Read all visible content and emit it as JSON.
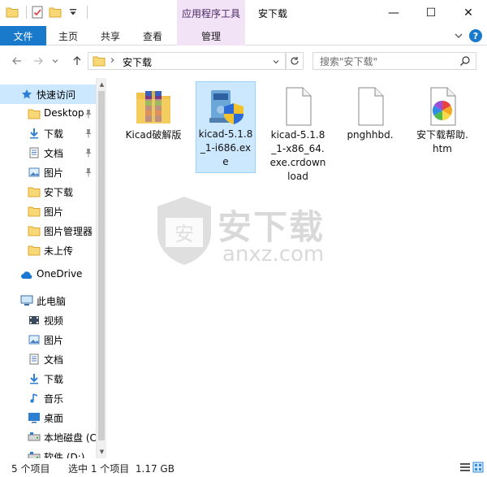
{
  "window": {
    "title": "安下载",
    "context_tab_header": "应用程序工具",
    "minimize_glyph": "—",
    "maximize_glyph": "☐",
    "close_glyph": "✕"
  },
  "ribbon": {
    "tabs": [
      {
        "label": "文件"
      },
      {
        "label": "主页"
      },
      {
        "label": "共享"
      },
      {
        "label": "查看"
      },
      {
        "label": "管理"
      }
    ],
    "help_glyph": "?"
  },
  "address_bar": {
    "path_segment": "安下载",
    "separator": "›"
  },
  "search": {
    "placeholder": "搜索\"安下载\""
  },
  "nav_pane": {
    "items": [
      {
        "label": "快速访问",
        "icon": "star-icon"
      },
      {
        "label": "Desktop",
        "icon": "folder-icon",
        "pinned": true
      },
      {
        "label": "下载",
        "icon": "download-icon",
        "pinned": true
      },
      {
        "label": "文档",
        "icon": "document-icon",
        "pinned": true
      },
      {
        "label": "图片",
        "icon": "picture-icon",
        "pinned": true
      },
      {
        "label": "安下载",
        "icon": "folder-icon"
      },
      {
        "label": "图片",
        "icon": "folder-icon"
      },
      {
        "label": "图片管理器",
        "icon": "folder-icon"
      },
      {
        "label": "未上传",
        "icon": "folder-icon"
      },
      {
        "label": "OneDrive",
        "icon": "cloud-icon"
      },
      {
        "label": "此电脑",
        "icon": "computer-icon"
      },
      {
        "label": "视频",
        "icon": "video-icon"
      },
      {
        "label": "图片",
        "icon": "picture-icon"
      },
      {
        "label": "文档",
        "icon": "document-icon"
      },
      {
        "label": "下载",
        "icon": "download-icon"
      },
      {
        "label": "音乐",
        "icon": "music-icon"
      },
      {
        "label": "桌面",
        "icon": "desktop-icon"
      },
      {
        "label": "本地磁盘 (C",
        "icon": "drive-icon"
      },
      {
        "label": "软件 (D:)",
        "icon": "drive-icon"
      }
    ]
  },
  "files": [
    {
      "label": "Kicad破解版",
      "icon": "winrar-folder-icon",
      "selected": false
    },
    {
      "label": "kicad-5.1.8_1-i686.exe",
      "icon": "installer-icon",
      "selected": true
    },
    {
      "label": "kicad-5.1.8_1-x86_64.exe.crdownload",
      "icon": "blank-file-icon",
      "selected": false
    },
    {
      "label": "pnghhbd.",
      "icon": "blank-file-icon",
      "selected": false
    },
    {
      "label": "安下载帮助.htm",
      "icon": "htm-file-icon",
      "selected": false
    }
  ],
  "watermark": {
    "text": "安下载",
    "subtext": "anxz.com"
  },
  "status_bar": {
    "item_count": "5 个项目",
    "selection": "选中 1 个项目  1.17 GB"
  },
  "colors": {
    "accent": "#1979ca",
    "selection": "#cce8ff",
    "context_tab": "#f3e3f7",
    "folder": "#f8d775"
  }
}
